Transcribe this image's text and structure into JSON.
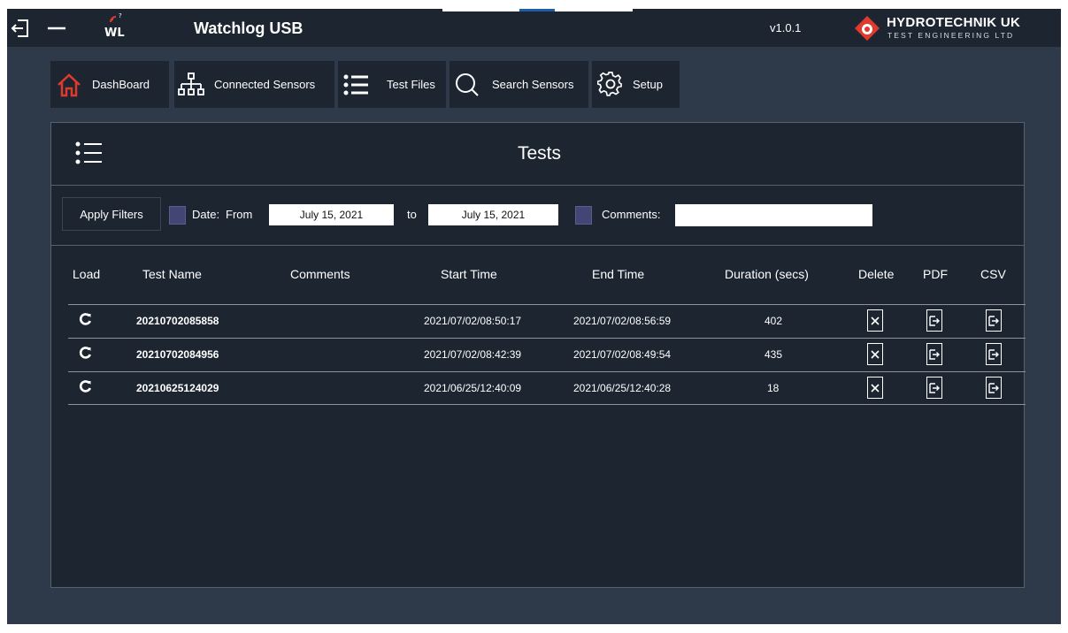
{
  "topbar": {
    "app_title": "Watchlog USB",
    "version": "v1.0.1",
    "brand_name": "HYDROTECHNIK UK",
    "brand_sub": "TEST ENGINEERING LTD",
    "logo_text": "WL"
  },
  "nav": [
    {
      "label": "DashBoard",
      "icon": "home-icon"
    },
    {
      "label": "Connected Sensors",
      "icon": "network-icon"
    },
    {
      "label": "Test Files",
      "icon": "list-icon"
    },
    {
      "label": "Search Sensors",
      "icon": "search-icon"
    },
    {
      "label": "Setup",
      "icon": "gear-icon"
    }
  ],
  "panel": {
    "title": "Tests",
    "filters": {
      "apply_label": "Apply Filters",
      "date_label": "Date:",
      "from_label": "From",
      "from_value": "July 15, 2021",
      "to_label": "to",
      "to_value": "July 15, 2021",
      "comments_label": "Comments:",
      "comments_value": ""
    },
    "columns": [
      "Load",
      "Test Name",
      "Comments",
      "Start Time",
      "End Time",
      "Duration (secs)",
      "Delete",
      "PDF",
      "CSV"
    ],
    "rows": [
      {
        "test_name": "20210702085858",
        "comments": "",
        "start": "2021/07/02/08:50:17",
        "end": "2021/07/02/08:56:59",
        "duration": "402"
      },
      {
        "test_name": "20210702084956",
        "comments": "",
        "start": "2021/07/02/08:42:39",
        "end": "2021/07/02/08:49:54",
        "duration": "435"
      },
      {
        "test_name": "20210625124029",
        "comments": "",
        "start": "2021/06/25/12:40:09",
        "end": "2021/06/25/12:40:28",
        "duration": "18"
      }
    ]
  },
  "colors": {
    "background": "#2e3a4a",
    "bar": "#1c2530",
    "brand_red": "#e03a2e",
    "checkbox": "#434674"
  }
}
